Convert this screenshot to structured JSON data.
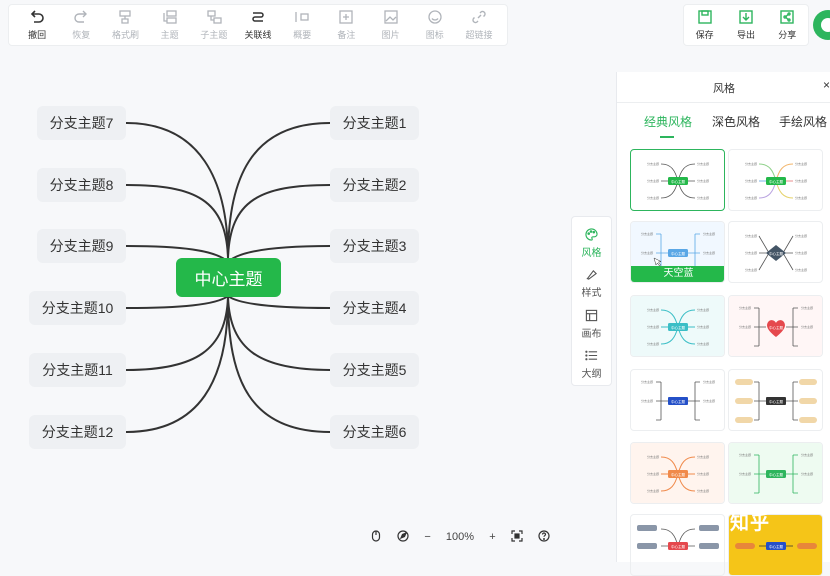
{
  "toolbar": {
    "items": [
      {
        "label": "撤回",
        "icon": "undo-icon",
        "active": true
      },
      {
        "label": "恢复",
        "icon": "redo-icon",
        "active": false
      },
      {
        "label": "格式刷",
        "icon": "format-brush-icon",
        "active": false
      },
      {
        "label": "主题",
        "icon": "topic-icon",
        "active": false
      },
      {
        "label": "子主题",
        "icon": "subtopic-icon",
        "active": false
      },
      {
        "label": "关联线",
        "icon": "relation-line-icon",
        "active": true
      },
      {
        "label": "概要",
        "icon": "summary-icon",
        "active": false
      },
      {
        "label": "备注",
        "icon": "note-icon",
        "active": false
      },
      {
        "label": "图片",
        "icon": "image-icon",
        "active": false
      },
      {
        "label": "图标",
        "icon": "emoji-icon",
        "active": false
      },
      {
        "label": "超链接",
        "icon": "link-icon",
        "active": false
      }
    ],
    "right": [
      {
        "label": "保存",
        "icon": "save-icon"
      },
      {
        "label": "导出",
        "icon": "export-icon"
      },
      {
        "label": "分享",
        "icon": "share-icon"
      }
    ]
  },
  "mindmap": {
    "center": "中心主题",
    "left": [
      "分支主题7",
      "分支主题8",
      "分支主题9",
      "分支主题10",
      "分支主题11",
      "分支主题12"
    ],
    "right": [
      "分支主题1",
      "分支主题2",
      "分支主题3",
      "分支主题4",
      "分支主题5",
      "分支主题6"
    ],
    "accent": "#24b84a"
  },
  "bottom": {
    "zoom": "100%",
    "minus": "−",
    "plus": "+"
  },
  "side_tabs": [
    {
      "label": "风格",
      "icon": "palette-icon",
      "active": true
    },
    {
      "label": "样式",
      "icon": "style-icon",
      "active": false
    },
    {
      "label": "画布",
      "icon": "canvas-icon",
      "active": false
    },
    {
      "label": "大纲",
      "icon": "outline-icon",
      "active": false
    }
  ],
  "panel": {
    "title": "风格",
    "close": "×",
    "tabs": [
      "经典风格",
      "深色风格",
      "手绘风格"
    ],
    "hover_label": "天空蓝",
    "thumbnail_center": "中心主题",
    "thumbnail_branch": "分支主题"
  },
  "watermark": "知乎"
}
